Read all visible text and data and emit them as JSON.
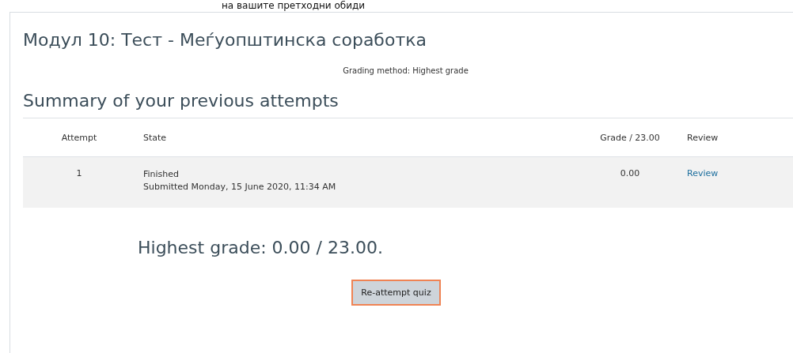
{
  "page_heading": "на вашите претходни обиди",
  "quiz": {
    "title": "Модул 10: Тест - Меѓуопштинска соработка",
    "grading_method": "Grading method: Highest grade"
  },
  "summary": {
    "heading": "Summary of your previous attempts",
    "columns": [
      "Attempt",
      "State",
      "Grade / 23.00",
      "Review"
    ],
    "rows": [
      {
        "attempt": "1",
        "state": "Finished",
        "submitted": "Submitted Monday, 15 June 2020, 11:34 AM",
        "grade": "0.00",
        "review": "Review"
      }
    ]
  },
  "feedback": "Highest grade: 0.00 / 23.00.",
  "buttons": [
    {
      "label": "Re-attempt quiz",
      "focused": true
    }
  ]
}
